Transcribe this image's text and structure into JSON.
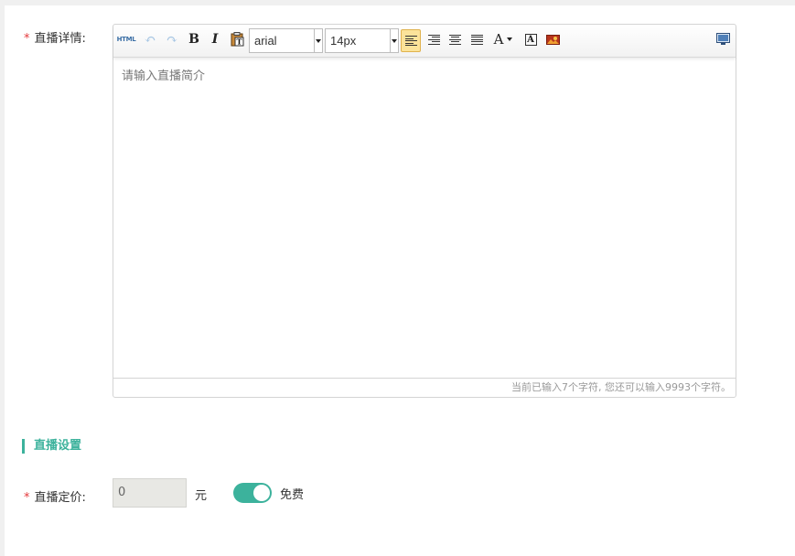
{
  "detail": {
    "label": "直播详情:",
    "placeholder": "请输入直播简介",
    "char_count": "当前已输入7个字符, 您还可以输入9993个字符。"
  },
  "toolbar": {
    "html_label": "HTML",
    "undo_symbol": "↶",
    "redo_symbol": "↷",
    "bold_label": "B",
    "italic_label": "I",
    "font_family": "arial",
    "font_size": "14px",
    "font_color_label": "A",
    "bg_color_label": "A",
    "active_button": "align-left"
  },
  "settings": {
    "section_title": "直播设置",
    "price_label": "直播定价:",
    "price_value": "0",
    "unit": "元",
    "free_label": "免费",
    "free_enabled": true
  },
  "colors": {
    "accent": "#3cb29c",
    "required": "#e4393c"
  }
}
